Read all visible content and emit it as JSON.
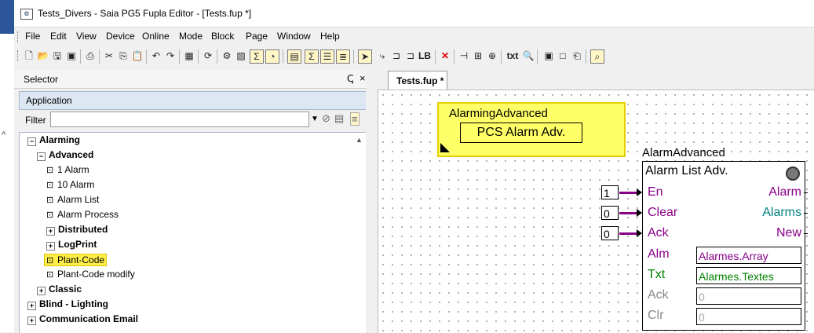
{
  "window": {
    "title": "Tests_Divers - Saia PG5 Fupla Editor - [Tests.fup *]"
  },
  "menu": [
    "File",
    "Edit",
    "View",
    "Device",
    "Online",
    "Mode",
    "Block",
    "Page",
    "Window",
    "Help"
  ],
  "toolbar": {
    "lb_label": "LB",
    "txt_label": "txt"
  },
  "selector": {
    "title": "Selector",
    "pin": "ↅ",
    "close": "×",
    "section": "Application",
    "filter_label": "Filter",
    "filter_value": ""
  },
  "tree": [
    {
      "label": "Alarming",
      "level": 0,
      "expand": "−",
      "bold": true
    },
    {
      "label": "Advanced",
      "level": 1,
      "expand": "−",
      "bold": true
    },
    {
      "label": "1 Alarm",
      "level": 2,
      "icon": "block"
    },
    {
      "label": "10 Alarm",
      "level": 2,
      "icon": "block"
    },
    {
      "label": "Alarm List",
      "level": 2,
      "icon": "block"
    },
    {
      "label": "Alarm Process",
      "level": 2,
      "icon": "block"
    },
    {
      "label": "Distributed",
      "level": 2,
      "expand": "+",
      "bold": true
    },
    {
      "label": "LogPrint",
      "level": 2,
      "expand": "+",
      "bold": true
    },
    {
      "label": "Plant-Code",
      "level": 2,
      "icon": "block",
      "highlight": true
    },
    {
      "label": "Plant-Code modify",
      "level": 2,
      "icon": "block"
    },
    {
      "label": "Classic",
      "level": 1,
      "expand": "+",
      "bold": true
    },
    {
      "label": "Blind - Lighting",
      "level": 0,
      "expand": "+",
      "bold": true
    },
    {
      "label": "Communication Email",
      "level": 0,
      "expand": "+",
      "bold": true
    }
  ],
  "editor": {
    "tab": "Tests.fup *"
  },
  "pcs_block": {
    "name": "AlarmingAdvanced",
    "label": "PCS Alarm Adv."
  },
  "alarm_block": {
    "name": "AlarmAdvanced",
    "title": "Alarm List Adv.",
    "inputs": [
      {
        "label": "En",
        "value": "1"
      },
      {
        "label": "Clear",
        "value": "0"
      },
      {
        "label": "Ack",
        "value": "0"
      }
    ],
    "outputs": [
      {
        "label": "Alarm",
        "color": "#880088"
      },
      {
        "label": "Alarms",
        "color": "#008080"
      },
      {
        "label": "New",
        "color": "#880088"
      }
    ],
    "params": [
      {
        "label": "Alm",
        "value": "Alarmes.Array",
        "label_color": "#880088",
        "value_color": "#880088"
      },
      {
        "label": "Txt",
        "value": "Alarmes.Textes",
        "label_color": "#008000",
        "value_color": "#008000"
      },
      {
        "label": "Ack",
        "value": "0",
        "label_color": "#888888",
        "value_color": "#aaaaaa"
      },
      {
        "label": "Clr",
        "value": "0",
        "label_color": "#888888",
        "value_color": "#aaaaaa"
      }
    ]
  }
}
